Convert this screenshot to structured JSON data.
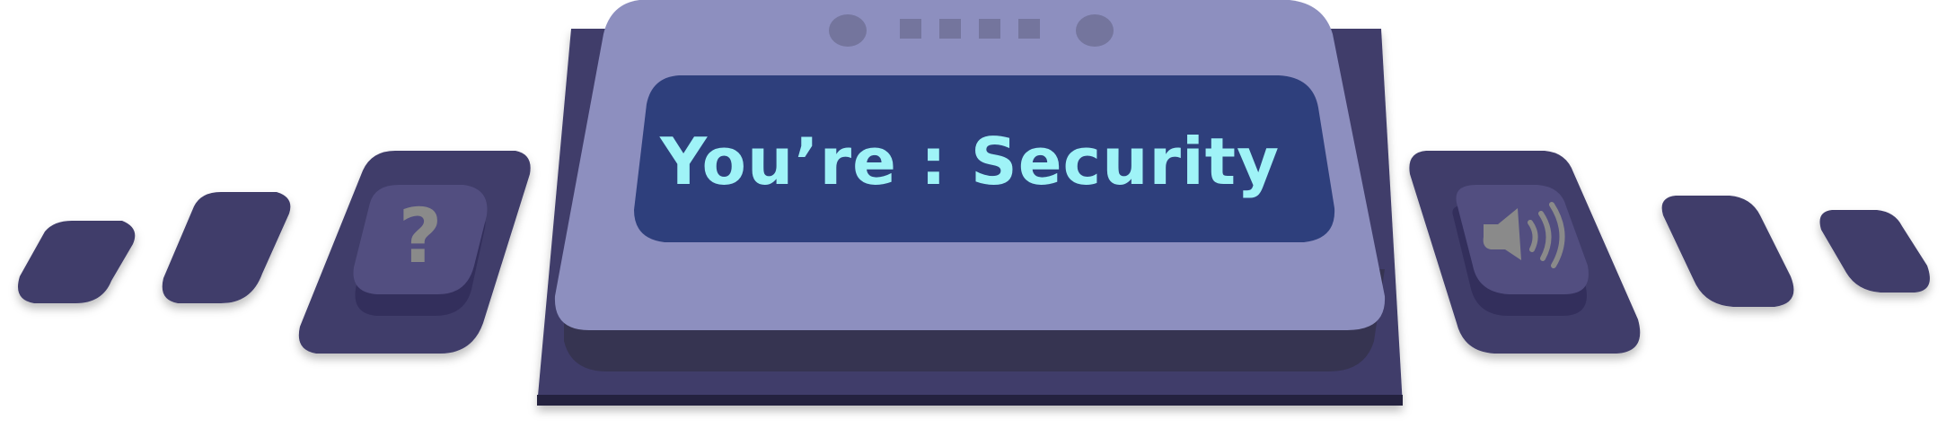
{
  "role_panel": {
    "prefix": "You’re",
    "separator": " : ",
    "role": "Security"
  },
  "controls": {
    "help_button": {
      "icon": "question-mark-icon"
    },
    "sound_button": {
      "icon": "speaker-volume-icon"
    }
  },
  "colors": {
    "panel_face": "#8d8fbf",
    "screen": "#2e3f7c",
    "role_text": "#9ff3f7",
    "side_tiles": "#3f3c6b",
    "button_face": "#524e80",
    "icon_gray": "#8a8a8a"
  }
}
